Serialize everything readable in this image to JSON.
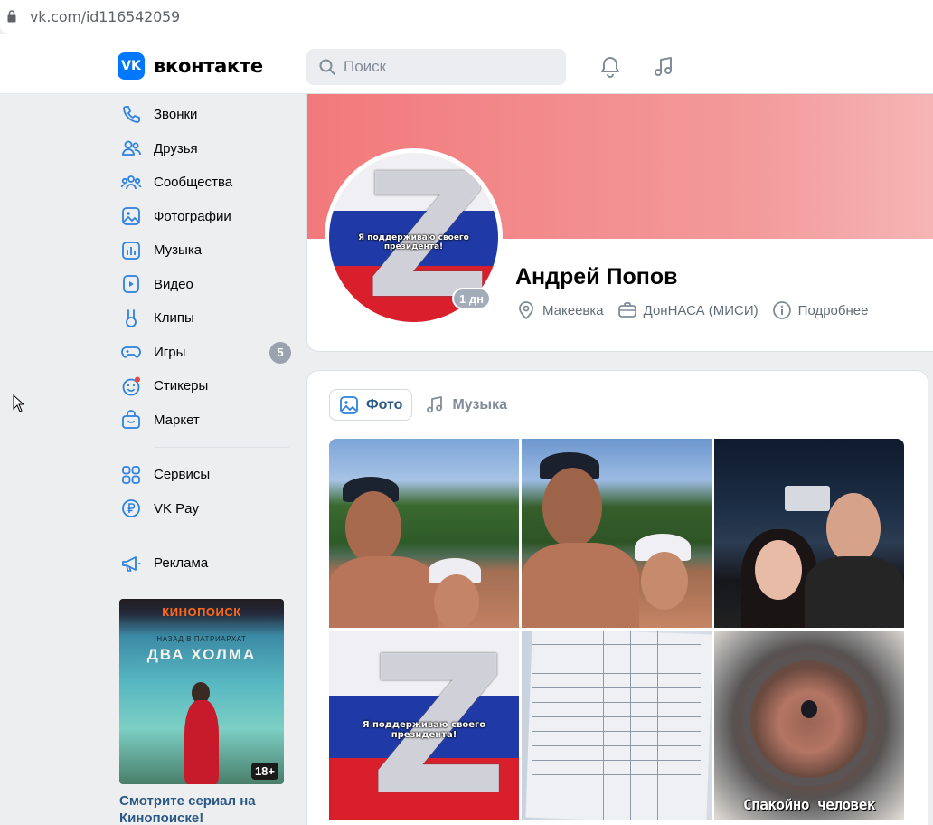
{
  "browser": {
    "url": "vk.com/id116542059"
  },
  "header": {
    "logo_mark": "VK",
    "logo_text": "вконтакте",
    "search_placeholder": "Поиск"
  },
  "nav": {
    "items": [
      {
        "label": "Звонки",
        "icon": "phone-icon"
      },
      {
        "label": "Друзья",
        "icon": "friends-icon"
      },
      {
        "label": "Сообщества",
        "icon": "communities-icon"
      },
      {
        "label": "Фотографии",
        "icon": "photos-icon"
      },
      {
        "label": "Музыка",
        "icon": "music-icon"
      },
      {
        "label": "Видео",
        "icon": "video-icon"
      },
      {
        "label": "Клипы",
        "icon": "clips-icon"
      },
      {
        "label": "Игры",
        "icon": "games-icon",
        "badge": "5"
      },
      {
        "label": "Стикеры",
        "icon": "stickers-icon"
      },
      {
        "label": "Маркет",
        "icon": "market-icon"
      }
    ],
    "items2": [
      {
        "label": "Сервисы",
        "icon": "services-icon"
      },
      {
        "label": "VK Pay",
        "icon": "vkpay-icon"
      }
    ],
    "items3": [
      {
        "label": "Реклама",
        "icon": "ads-icon"
      }
    ]
  },
  "ad": {
    "brand": "КИНОПОИСК",
    "subtitle": "НАЗАД В ПАТРИАРХАТ",
    "title": "ДВА ХОЛМА",
    "age": "18+",
    "caption": "Смотрите сериал на Кинопоиске!"
  },
  "profile": {
    "name": "Андрей Попов",
    "online": "1 дн",
    "avatar_text": "Я поддерживаю своего президента!",
    "avatar_letter": "Z",
    "city": "Макеевка",
    "university": "ДонНАСА (МИСИ)",
    "more": "Подробнее"
  },
  "content": {
    "tabs": [
      {
        "label": "Фото",
        "active": true
      },
      {
        "label": "Музыка",
        "active": false
      }
    ],
    "photo_flag_text": "Я поддерживаю своего президента!",
    "photo_flag_letter": "Z",
    "meme_text": "Спакойно человек"
  },
  "colors": {
    "accent": "#0077ff",
    "link": "#2a5885",
    "badge": "#99a2ad"
  }
}
